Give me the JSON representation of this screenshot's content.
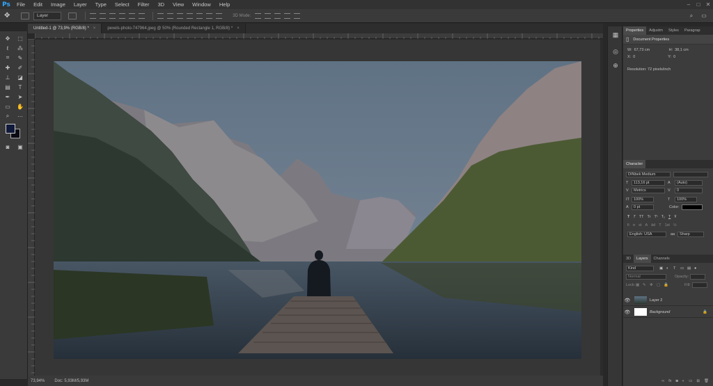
{
  "app": {
    "logo": "Ps"
  },
  "menu": [
    "File",
    "Edit",
    "Image",
    "Layer",
    "Type",
    "Select",
    "Filter",
    "3D",
    "View",
    "Window",
    "Help"
  ],
  "window_controls": [
    "–",
    "□",
    "✕"
  ],
  "options_bar": {
    "auto_select_value": "Layer",
    "mode_3d_label": "3D Mode:"
  },
  "tabs": [
    {
      "label": "Untitled-1 @ 73,9% (RGB/8) *"
    },
    {
      "label": "pexels-photo-747964.jpeg @ 50% (Rounded Rectangle 1, RGB/8) *"
    }
  ],
  "status": {
    "zoom": "73,94%",
    "doc": "Doc: 5,93M/5,93M"
  },
  "properties": {
    "tabs": [
      "Properties",
      "Adjustm",
      "Styles",
      "Paragrap"
    ],
    "title": "Document Properties",
    "w_label": "W:",
    "w_value": "67,73 cm",
    "h_label": "H:",
    "h_value": "38,1 cm",
    "x_label": "X:",
    "x_value": "0",
    "y_label": "Y:",
    "y_value": "0",
    "resolution": "Resolution: 72 pixels/inch"
  },
  "character": {
    "tab": "Character",
    "font_family": "DINbek Medium",
    "font_size": "113,16 pt",
    "leading": "(Auto)",
    "kerning": "Metrics",
    "tracking": "0",
    "vscale": "100%",
    "hscale": "100%",
    "baseline": "0 pt",
    "color_label": "Color:",
    "color_value": "#000000",
    "styles": [
      "T",
      "T",
      "TT",
      "Tr",
      "T¹",
      "T₁",
      "T",
      "Ŧ"
    ],
    "opentype": [
      "fi",
      "σ",
      "st",
      "A",
      "ād",
      "T",
      "1st",
      "½"
    ],
    "language": "English: USA",
    "antialias": "Sharp"
  },
  "layers_panel": {
    "tabs": [
      "3D",
      "Layers",
      "Channels"
    ],
    "filter": "Kind",
    "blend_mode": "Normal",
    "opacity_label": "Opacity:",
    "lock_label": "Lock:",
    "fill_label": "Fill:",
    "layers": [
      {
        "name": "Layer 2",
        "thumb": "photo"
      },
      {
        "name": "Background",
        "thumb": "white"
      }
    ]
  }
}
